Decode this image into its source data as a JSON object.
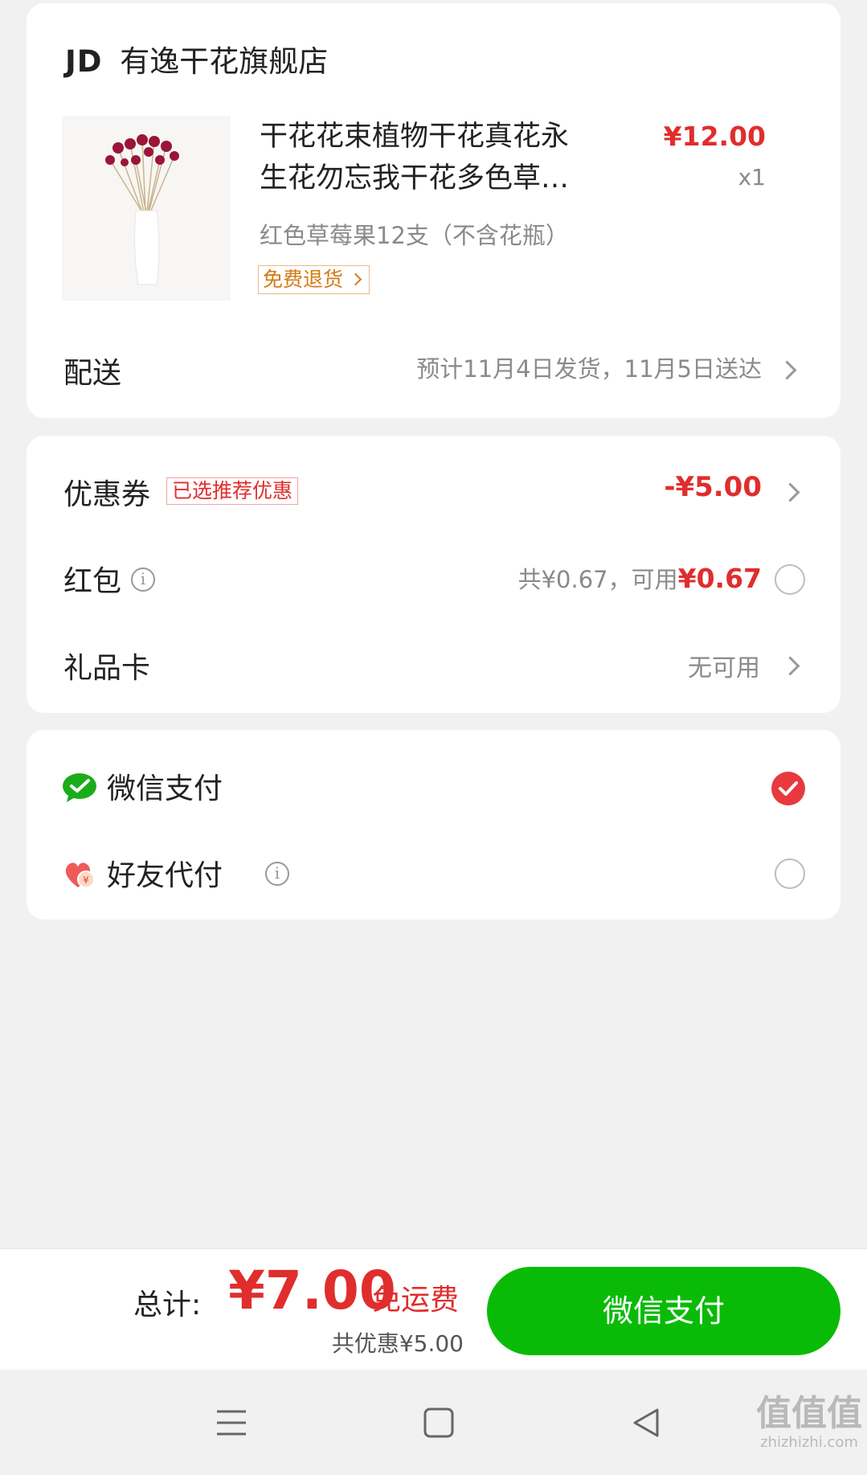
{
  "store": {
    "logo": "JD",
    "name": "有逸干花旗舰店"
  },
  "product": {
    "title_line1": "干花花束植物干花真花永",
    "title_line2": "生花勿忘我干花多色草…",
    "price": "¥12.00",
    "quantity": "x1",
    "variant": "红色草莓果12支（不含花瓶）",
    "badge": "免费退货"
  },
  "delivery": {
    "label": "配送",
    "value": "预计11月4日发货，11月5日送达"
  },
  "discounts": {
    "coupon_label": "优惠券",
    "coupon_tag": "已选推荐优惠",
    "coupon_value": "-¥5.00",
    "redpacket_label": "红包",
    "redpacket_total": "共¥0.67，可用",
    "redpacket_available": "¥0.67",
    "giftcard_label": "礼品卡",
    "giftcard_value": "无可用"
  },
  "payment": {
    "wechat_label": "微信支付",
    "friend_label": "好友代付",
    "selected": "wechat"
  },
  "footer": {
    "total_label": "总计:",
    "total_value": "¥7.00",
    "shipping": "免运费",
    "saved": "共优惠¥5.00",
    "pay_button": "微信支付"
  },
  "watermark": {
    "text": "值值值",
    "url": "zhizhizhi.com"
  },
  "colors": {
    "accent_red": "#e02d2d",
    "pay_green": "#09bb07",
    "badge_orange": "#d47a12"
  },
  "icons": [
    "wechat-pay-icon",
    "friend-pay-heart-icon",
    "info-icon",
    "chevron-right-icon",
    "checkmark-icon",
    "menu-icon",
    "home-square-icon",
    "back-triangle-icon"
  ]
}
